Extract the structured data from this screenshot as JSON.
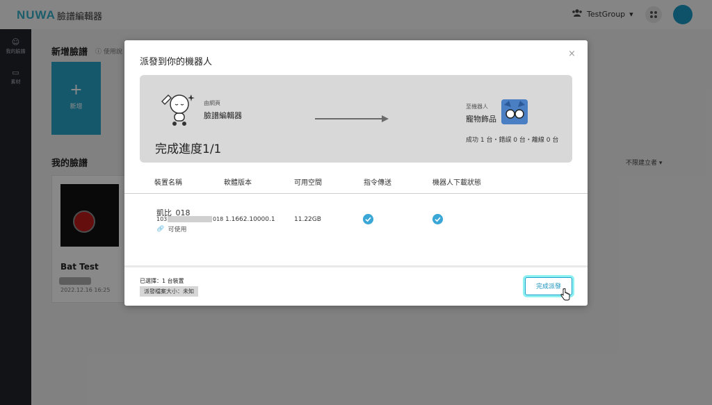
{
  "app": {
    "logo": "NUWA",
    "name": "臉譜編輯器"
  },
  "topbar": {
    "group": "TestGroup"
  },
  "sidebar": {
    "items": [
      {
        "label": "我的臉譜"
      },
      {
        "label": "素材"
      }
    ]
  },
  "content": {
    "new_section_title": "新增臉譜",
    "new_section_hint": "使用說",
    "new_card_plus": "+",
    "new_card_label": "新增",
    "my_faces_title": "我的臉譜",
    "filter_label": "不限建立者",
    "face": {
      "name": "Bat Test",
      "date": "2022.12.16 16:25"
    }
  },
  "modal": {
    "title": "派發到你的機器人",
    "close": "×",
    "banner": {
      "source_sub": "由網頁",
      "source_name": "臉譜編輯器",
      "dest_sub": "至機器人",
      "dest_name": "寵物飾品",
      "progress": "完成進度1/1",
      "summary": "成功 1 台・錯誤 0 台・離線 0 台"
    },
    "columns": [
      "裝置名稱",
      "軟體版本",
      "可用空間",
      "指令傳送",
      "機器人下載狀態"
    ],
    "rows": [
      {
        "name": "凱比_018",
        "id_prefix": "103",
        "id_suffix": "018",
        "status": "可使用",
        "firmware": "1.1662.10000.1",
        "space": "11.22GB",
        "command_sent": true,
        "download_done": true
      }
    ],
    "footer": {
      "selected": "已選擇：1 台裝置",
      "size": "派發檔案大小：未知",
      "done_button": "完成派發"
    }
  },
  "colors": {
    "accent": "#1aa1c9",
    "check": "#3ba7d7",
    "sidebar": "#1f242b",
    "new_card": "#279fc4"
  }
}
